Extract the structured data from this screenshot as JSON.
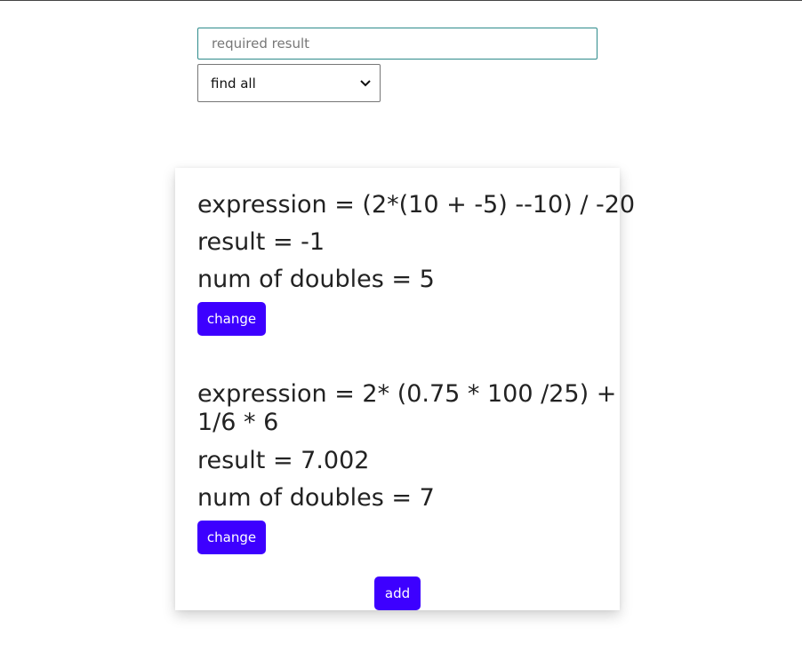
{
  "search": {
    "placeholder": "required result",
    "value": ""
  },
  "filter": {
    "selected": "find all"
  },
  "entries": [
    {
      "expression_line": "expression = (2*(10 + -5) --10) / -20",
      "result_line": "result = -1",
      "doubles_line": "num of doubles = 5",
      "change_label": "change"
    },
    {
      "expression_line_1": "expression = 2* (0.75 * 100 /25) +",
      "expression_line_2": "1/6 * 6",
      "result_line": "result = 7.002",
      "doubles_line": "num of doubles = 7",
      "change_label": "change"
    }
  ],
  "add_label": "add",
  "colors": {
    "button": "#3d00ff",
    "input_border": "#2e8b8b"
  }
}
